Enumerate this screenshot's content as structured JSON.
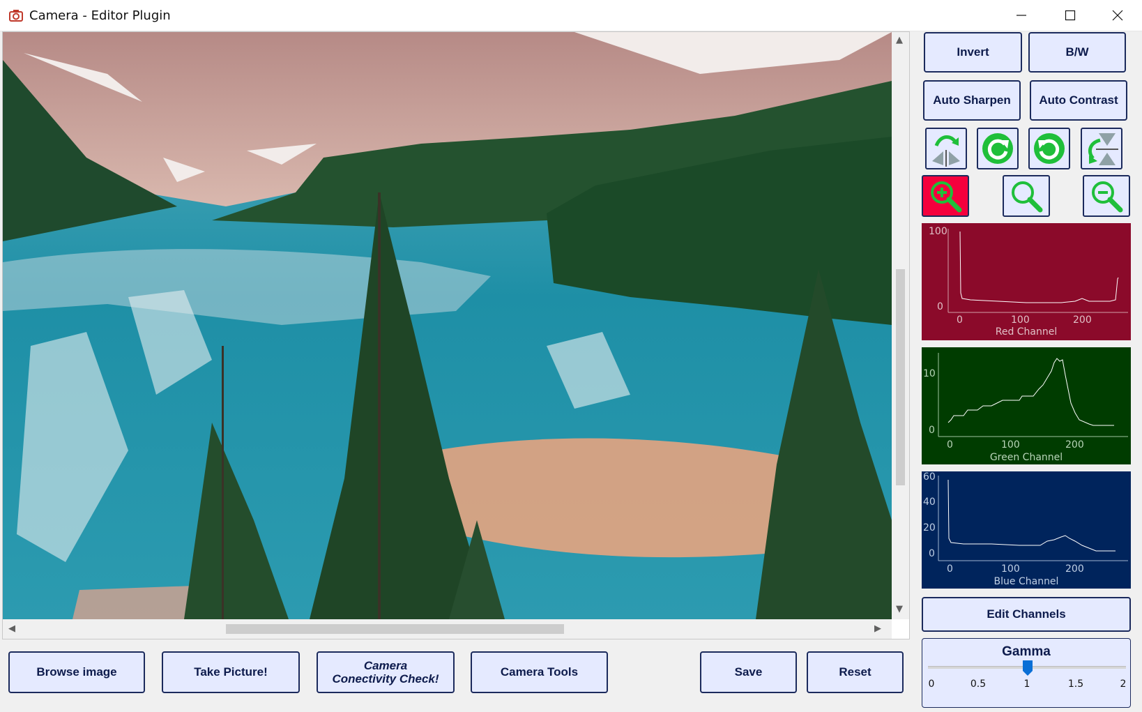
{
  "window": {
    "title": "Camera - Editor Plugin"
  },
  "right_panel": {
    "invert_label": "Invert",
    "bw_label": "B/W",
    "auto_sharpen_label": "Auto Sharpen",
    "auto_contrast_label": "Auto Contrast",
    "edit_channels_label": "Edit Channels"
  },
  "histograms": [
    {
      "channel": "Red Channel",
      "bg": "#8b0a2a",
      "yticks": [
        "100",
        "0"
      ],
      "xticks": [
        "0",
        "100",
        "200"
      ]
    },
    {
      "channel": "Green Channel",
      "bg": "#003c00",
      "yticks": [
        "10",
        "0"
      ],
      "xticks": [
        "0",
        "100",
        "200"
      ]
    },
    {
      "channel": "Blue Channel",
      "bg": "#00245c",
      "yticks": [
        "60",
        "40",
        "20",
        "0"
      ],
      "xticks": [
        "0",
        "100",
        "200"
      ]
    }
  ],
  "gamma": {
    "title": "Gamma",
    "ticks": [
      "0",
      "0.5",
      "1",
      "1.5",
      "2"
    ],
    "value": 1
  },
  "bottom_bar": {
    "browse_label": "Browse image",
    "take_picture_label": "Take Picture!",
    "connectivity_line1": "Camera",
    "connectivity_line2": "Conectivity Check!",
    "camera_tools_label": "Camera Tools",
    "save_label": "Save",
    "reset_label": "Reset"
  },
  "colors": {
    "button_bg": "#e5eaff",
    "button_border": "#1b2a5c",
    "active_zoom": "#f5003d",
    "icon_green": "#1fbf3a"
  }
}
